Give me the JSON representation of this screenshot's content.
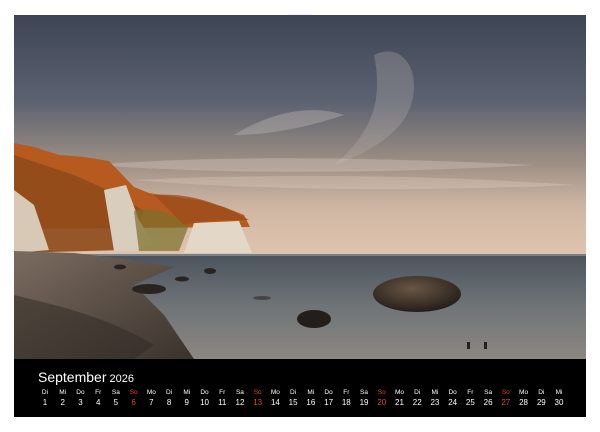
{
  "calendar": {
    "month": "September",
    "year": "2026",
    "days": [
      {
        "wd": "Di",
        "d": "1",
        "sun": false
      },
      {
        "wd": "Mi",
        "d": "2",
        "sun": false
      },
      {
        "wd": "Do",
        "d": "3",
        "sun": false
      },
      {
        "wd": "Fr",
        "d": "4",
        "sun": false
      },
      {
        "wd": "Sa",
        "d": "5",
        "sun": false
      },
      {
        "wd": "So",
        "d": "6",
        "sun": true
      },
      {
        "wd": "Mo",
        "d": "7",
        "sun": false
      },
      {
        "wd": "Di",
        "d": "8",
        "sun": false
      },
      {
        "wd": "Mi",
        "d": "9",
        "sun": false
      },
      {
        "wd": "Do",
        "d": "10",
        "sun": false
      },
      {
        "wd": "Fr",
        "d": "11",
        "sun": false
      },
      {
        "wd": "Sa",
        "d": "12",
        "sun": false
      },
      {
        "wd": "So",
        "d": "13",
        "sun": true
      },
      {
        "wd": "Mo",
        "d": "14",
        "sun": false
      },
      {
        "wd": "Di",
        "d": "15",
        "sun": false
      },
      {
        "wd": "Mi",
        "d": "16",
        "sun": false
      },
      {
        "wd": "Do",
        "d": "17",
        "sun": false
      },
      {
        "wd": "Fr",
        "d": "18",
        "sun": false
      },
      {
        "wd": "Sa",
        "d": "19",
        "sun": false
      },
      {
        "wd": "So",
        "d": "20",
        "sun": true
      },
      {
        "wd": "Mo",
        "d": "21",
        "sun": false
      },
      {
        "wd": "Di",
        "d": "22",
        "sun": false
      },
      {
        "wd": "Mi",
        "d": "23",
        "sun": false
      },
      {
        "wd": "Do",
        "d": "24",
        "sun": false
      },
      {
        "wd": "Fr",
        "d": "25",
        "sun": false
      },
      {
        "wd": "Sa",
        "d": "26",
        "sun": false
      },
      {
        "wd": "So",
        "d": "27",
        "sun": true
      },
      {
        "wd": "Mo",
        "d": "28",
        "sun": false
      },
      {
        "wd": "Di",
        "d": "29",
        "sun": false
      },
      {
        "wd": "Mi",
        "d": "30",
        "sun": false
      }
    ]
  },
  "colors": {
    "sunday": "#e0473a",
    "strip": "#000000",
    "binding": "#3a3f48"
  }
}
